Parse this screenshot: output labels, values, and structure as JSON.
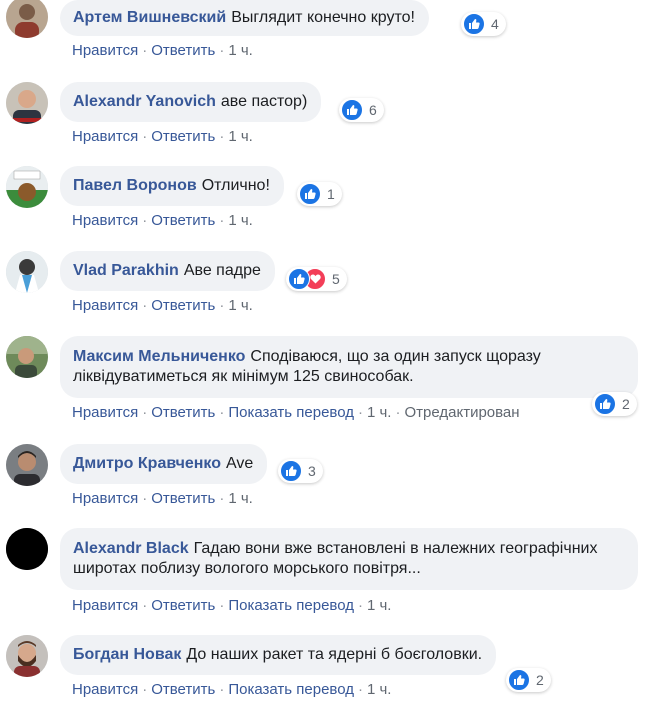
{
  "actions": {
    "like": "Нравится",
    "reply": "Ответить",
    "translate": "Показать перевод",
    "edited": "Отредактирован",
    "sep": "·"
  },
  "comments": [
    {
      "author": "Артем Вишневский",
      "text": "Выглядит конечно круто!",
      "time": "1 ч.",
      "reactions": "4"
    },
    {
      "author": "Alexandr Yanovich",
      "text": "аве пастор)",
      "time": "1 ч.",
      "reactions": "6"
    },
    {
      "author": "Павел Воронов",
      "text": "Отлично!",
      "time": "1 ч.",
      "reactions": "1"
    },
    {
      "author": "Vlad Parakhin",
      "text": "Аве падре",
      "time": "1 ч.",
      "reactions": "5"
    },
    {
      "author": "Максим Мельниченко",
      "text": "Сподіваюся, що за один запуск щоразу ліквідуватиметься як мінімум 125 свинособак.",
      "time": "1 ч.",
      "reactions": "2"
    },
    {
      "author": "Дмитро Кравченко",
      "text": "Ave",
      "time": "1 ч.",
      "reactions": "3"
    },
    {
      "author": "Alexandr Black",
      "text": "Гадаю вони вже встановлені в належних географічних широтах поблизу вологого морського повітря...",
      "time": "1 ч.",
      "reactions": ""
    },
    {
      "author": "Богдан Новак",
      "text": "До наших ракет та ядерні б боєголовки.",
      "time": "1 ч.",
      "reactions": "2"
    }
  ],
  "colors": {
    "link": "#385898",
    "bubble": "#f0f2f5",
    "like": "#1b74e4",
    "love": "#f33e58"
  }
}
